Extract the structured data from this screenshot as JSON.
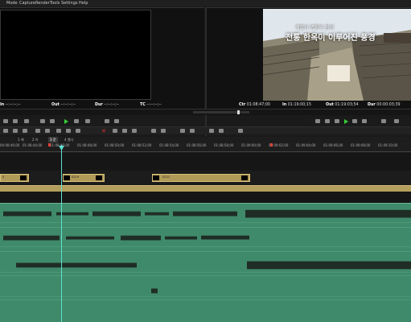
{
  "menu": [
    "Mode",
    "Capture",
    "Render",
    "Tools",
    "Settings",
    "Help"
  ],
  "left_monitor": {
    "in_label": "In",
    "in_value": "--:--:--;--",
    "out_label": "Out",
    "out_value": "--:--:--;--",
    "dur_label": "Dur",
    "dur_value": "--:--:--;--",
    "tc_label": "TC",
    "tc_value": "--:--:--;--"
  },
  "right_monitor": {
    "caption_small": "계절의 변화와 함께",
    "caption_large": "전통 한옥이 이루어진 풍경",
    "tc_label": "Ctr",
    "tc_value": "01:08:47;00",
    "in_label": "In",
    "in_value": "01:19:00;15",
    "out_label": "Out",
    "out_value": "01:19:03;54",
    "dur_label": "Dur",
    "dur_value": "00:00:03;39"
  },
  "timeline": {
    "tabs": [
      "1 에",
      "2 이",
      "3 문",
      "4 열다"
    ],
    "ruler": [
      "00:08:46;00",
      "01:08:44;00",
      "01:08:46;00",
      "01:08:48;00",
      "01:08:50;00",
      "01:08:52;00",
      "01:08:54;00",
      "01:08:56;00",
      "01:08:58;00",
      "01:09:00;00",
      "01:09:02;00",
      "01:09:04;00",
      "01:09:06;00",
      "01:09:08;00",
      "01:09:10;00"
    ],
    "clips": [
      {
        "label": "0"
      },
      {
        "label": "0219"
      },
      {
        "label": "0221"
      }
    ]
  },
  "colors": {
    "video_clip": "#b09a57",
    "audio_track": "#3f8a6a",
    "playhead": "#5fe0d0",
    "play_green": "#36d13a"
  }
}
